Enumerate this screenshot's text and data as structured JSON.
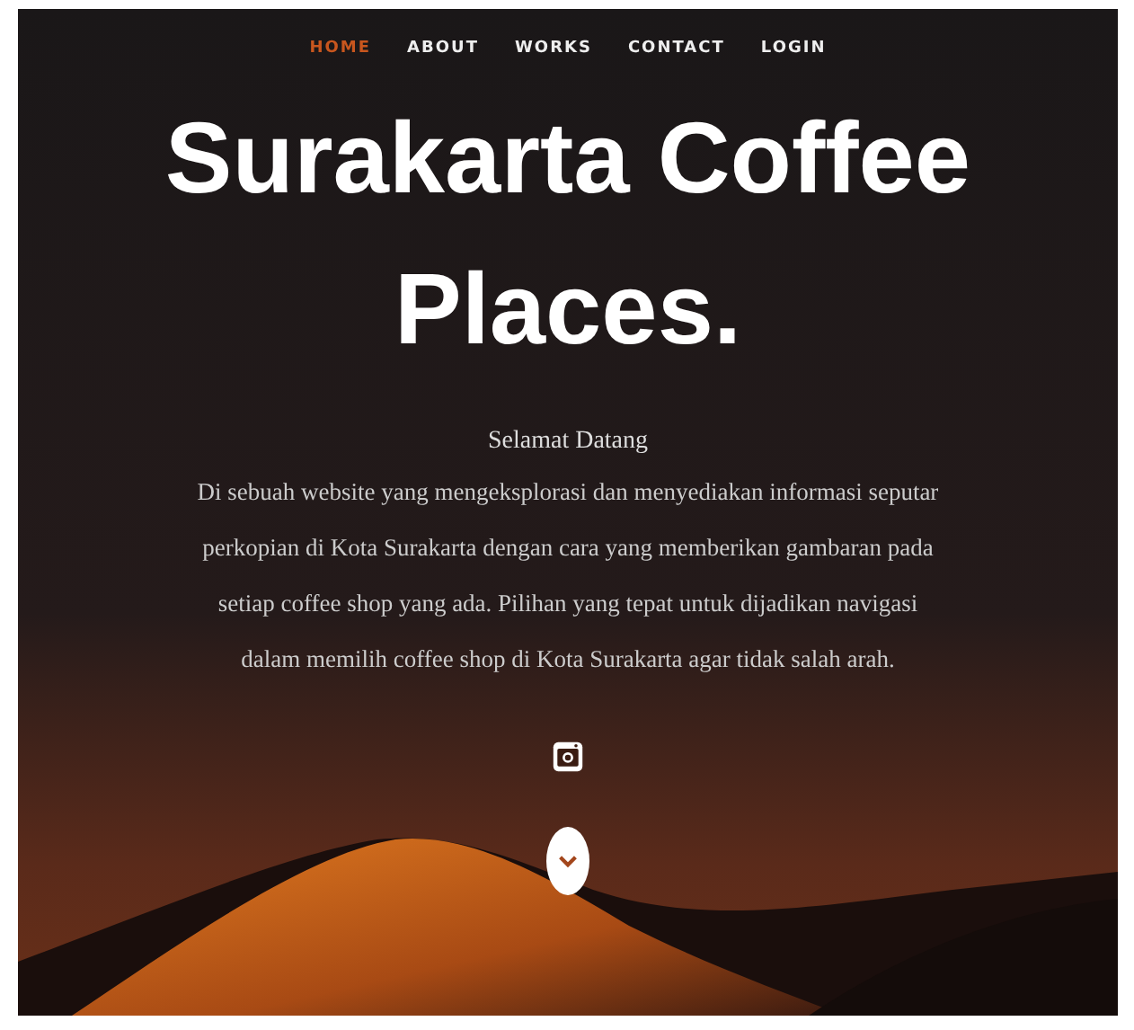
{
  "nav": [
    {
      "label": "HOME",
      "selected": true
    },
    {
      "label": "ABOUT",
      "selected": false
    },
    {
      "label": "WORKS",
      "selected": false
    },
    {
      "label": "CONTACT",
      "selected": false
    },
    {
      "label": "LOGIN",
      "selected": false
    }
  ],
  "hero": {
    "title": "Surakarta Coffee Places.",
    "subtitle": "Selamat Datang",
    "text": "Di sebuah website yang mengeksplorasi dan menyediakan informasi seputar perkopian di Kota Surakarta dengan cara yang memberikan gambaran pada setiap coffee shop yang ada. Pilihan yang tepat untuk dijadikan navigasi dalam memilih coffee shop di Kota Surakarta agar tidak salah arah."
  }
}
